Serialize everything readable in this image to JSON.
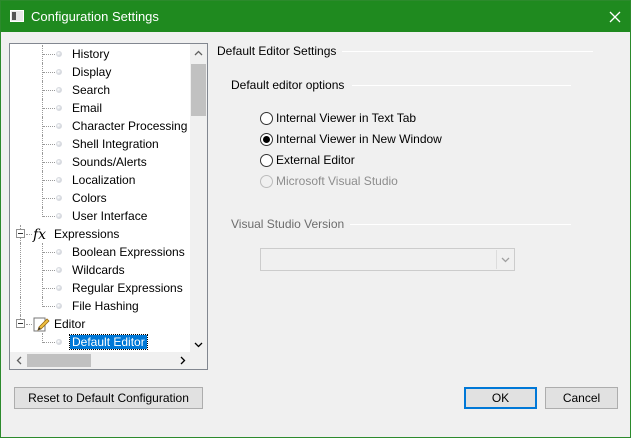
{
  "window": {
    "title": "Configuration Settings",
    "accent": "#1f8a1f",
    "selection_color": "#0078d7"
  },
  "tree": {
    "top_items": [
      {
        "label": "History"
      },
      {
        "label": "Display"
      },
      {
        "label": "Search"
      },
      {
        "label": "Email"
      },
      {
        "label": "Character Processing"
      },
      {
        "label": "Shell Integration"
      },
      {
        "label": "Sounds/Alerts"
      },
      {
        "label": "Localization"
      },
      {
        "label": "Colors"
      },
      {
        "label": "User Interface"
      }
    ],
    "expressions": {
      "label": "Expressions",
      "icon": "fx-icon",
      "icon_text": "fx",
      "items": [
        {
          "label": "Boolean Expressions"
        },
        {
          "label": "Wildcards"
        },
        {
          "label": "Regular Expressions"
        },
        {
          "label": "File Hashing"
        }
      ]
    },
    "editor": {
      "label": "Editor",
      "icon": "pencil-page-icon",
      "items": [
        {
          "label": "Default Editor",
          "selected": true
        }
      ]
    }
  },
  "panel": {
    "title": "Default Editor Settings",
    "options_group": "Default editor options",
    "radios": [
      {
        "label": "Internal Viewer in Text Tab",
        "checked": false,
        "enabled": true
      },
      {
        "label": "Internal Viewer in New Window",
        "checked": true,
        "enabled": true
      },
      {
        "label": "External Editor",
        "checked": false,
        "enabled": true
      },
      {
        "label": "Microsoft Visual Studio",
        "checked": false,
        "enabled": false
      }
    ],
    "vs_group": "Visual Studio Version",
    "vs_select_value": ""
  },
  "buttons": {
    "reset": "Reset to Default Configuration",
    "ok": "OK",
    "cancel": "Cancel"
  }
}
